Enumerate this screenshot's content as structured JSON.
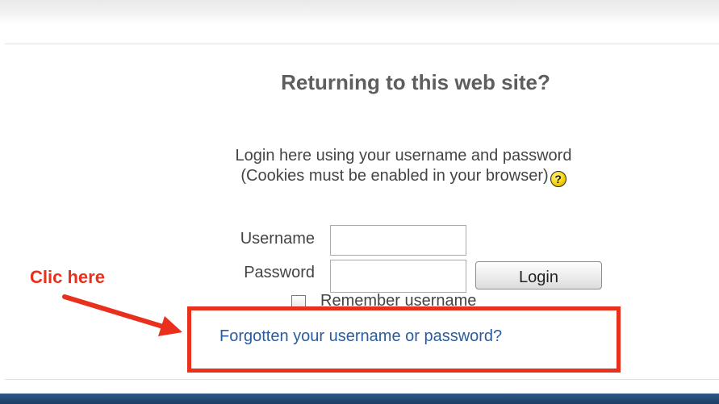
{
  "login": {
    "heading": "Returning to this web site?",
    "intro_line1": "Login here using your username and password",
    "intro_line2": "(Cookies must be enabled in your browser)",
    "help_icon_glyph": "?",
    "username_label": "Username",
    "username_value": "",
    "password_label": "Password",
    "password_value": "",
    "login_button_label": "Login",
    "remember_label": "Remember username",
    "remember_checked": false,
    "forgot_link": "Forgotten your username or password?"
  },
  "annotation": {
    "text": "Clic here",
    "color": "#e8301c"
  },
  "colors": {
    "link": "#2b5c9b",
    "heading": "#5e5e5e",
    "text": "#444444",
    "footer_bar": "#1c3f66"
  },
  "icons": {
    "help": "help-question-icon",
    "arrow": "red-arrow-icon"
  }
}
